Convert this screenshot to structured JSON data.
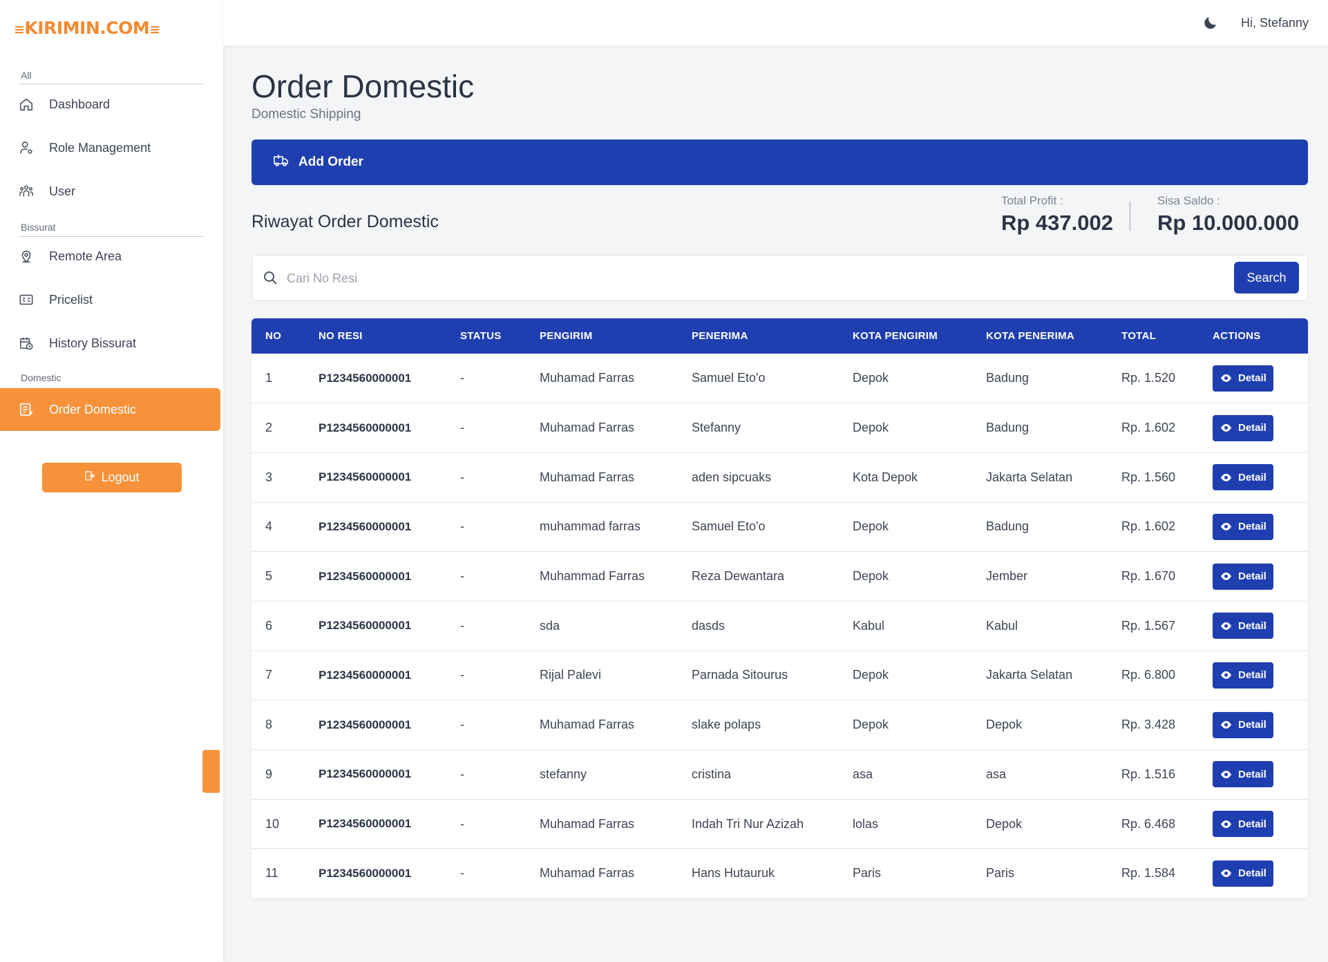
{
  "brand": {
    "logo_text": "KIRIMIN.COM",
    "logo_left_bars": "≡",
    "logo_right_bars": "≡"
  },
  "sidebar": {
    "sections": [
      {
        "label": "All"
      },
      {
        "label": "Bissurat"
      },
      {
        "label": "Domestic"
      }
    ],
    "items": [
      {
        "label": "Dashboard",
        "icon": "home-icon"
      },
      {
        "label": "Role Management",
        "icon": "user-cog-icon"
      },
      {
        "label": "User",
        "icon": "users-icon"
      },
      {
        "label": "Remote Area",
        "icon": "map-pin-icon"
      },
      {
        "label": "Pricelist",
        "icon": "price-tag-icon"
      },
      {
        "label": "History Bissurat",
        "icon": "calendar-history-icon"
      },
      {
        "label": "Order Domestic",
        "icon": "order-list-icon",
        "active": true
      }
    ],
    "logout_label": "Logout"
  },
  "topbar": {
    "greeting": "Hi, Stefanny",
    "theme_icon": "moon-icon"
  },
  "page": {
    "title": "Order Domestic",
    "subtitle": "Domestic Shipping",
    "add_order_label": "Add Order",
    "section_title": "Riwayat Order Domestic"
  },
  "stats": {
    "total_profit_label": "Total Profit :",
    "total_profit_value": "Rp 437.002",
    "sisa_saldo_label": "Sisa Saldo :",
    "sisa_saldo_value": "Rp 10.000.000"
  },
  "search": {
    "placeholder": "Cari No Resi",
    "value": "",
    "button_label": "Search"
  },
  "table": {
    "headers": [
      "NO",
      "NO RESI",
      "STATUS",
      "PENGIRIM",
      "PENERIMA",
      "KOTA PENGIRIM",
      "KOTA PENERIMA",
      "TOTAL",
      "ACTIONS"
    ],
    "action_label": "Detail",
    "rows": [
      {
        "no": "1",
        "resi": "P1234560000001",
        "status": "-",
        "pengirim": "Muhamad Farras",
        "penerima": "Samuel Eto'o",
        "kota_pengirim": "Depok",
        "kota_penerima": "Badung",
        "total": "Rp. 1.520"
      },
      {
        "no": "2",
        "resi": "P1234560000001",
        "status": "-",
        "pengirim": "Muhamad Farras",
        "penerima": "Stefanny",
        "kota_pengirim": "Depok",
        "kota_penerima": "Badung",
        "total": "Rp. 1.602"
      },
      {
        "no": "3",
        "resi": "P1234560000001",
        "status": "-",
        "pengirim": "Muhamad Farras",
        "penerima": "aden sipcuaks",
        "kota_pengirim": "Kota Depok",
        "kota_penerima": "Jakarta Selatan",
        "total": "Rp. 1.560"
      },
      {
        "no": "4",
        "resi": "P1234560000001",
        "status": "-",
        "pengirim": "muhammad farras",
        "penerima": "Samuel Eto'o",
        "kota_pengirim": "Depok",
        "kota_penerima": "Badung",
        "total": "Rp. 1.602"
      },
      {
        "no": "5",
        "resi": "P1234560000001",
        "status": "-",
        "pengirim": "Muhammad Farras",
        "penerima": "Reza Dewantara",
        "kota_pengirim": "Depok",
        "kota_penerima": "Jember",
        "total": "Rp. 1.670"
      },
      {
        "no": "6",
        "resi": "P1234560000001",
        "status": "-",
        "pengirim": "sda",
        "penerima": "dasds",
        "kota_pengirim": "Kabul",
        "kota_penerima": "Kabul",
        "total": "Rp. 1.567"
      },
      {
        "no": "7",
        "resi": "P1234560000001",
        "status": "-",
        "pengirim": "Rijal Palevi",
        "penerima": "Parnada Sitourus",
        "kota_pengirim": "Depok",
        "kota_penerima": "Jakarta Selatan",
        "total": "Rp. 6.800"
      },
      {
        "no": "8",
        "resi": "P1234560000001",
        "status": "-",
        "pengirim": "Muhamad Farras",
        "penerima": "slake polaps",
        "kota_pengirim": "Depok",
        "kota_penerima": "Depok",
        "total": "Rp. 3.428"
      },
      {
        "no": "9",
        "resi": "P1234560000001",
        "status": "-",
        "pengirim": "stefanny",
        "penerima": "cristina",
        "kota_pengirim": "asa",
        "kota_penerima": "asa",
        "total": "Rp. 1.516"
      },
      {
        "no": "10",
        "resi": "P1234560000001",
        "status": "-",
        "pengirim": "Muhamad Farras",
        "penerima": "Indah Tri Nur Azizah",
        "kota_pengirim": "lolas",
        "kota_penerima": "Depok",
        "total": "Rp. 6.468"
      },
      {
        "no": "11",
        "resi": "P1234560000001",
        "status": "-",
        "pengirim": "Muhamad Farras",
        "penerima": "Hans Hutauruk",
        "kota_pengirim": "Paris",
        "kota_penerima": "Paris",
        "total": "Rp. 1.584"
      }
    ]
  },
  "colors": {
    "primary": "#1f3fb0",
    "accent": "#f7923b",
    "background": "#f4f5f7"
  }
}
